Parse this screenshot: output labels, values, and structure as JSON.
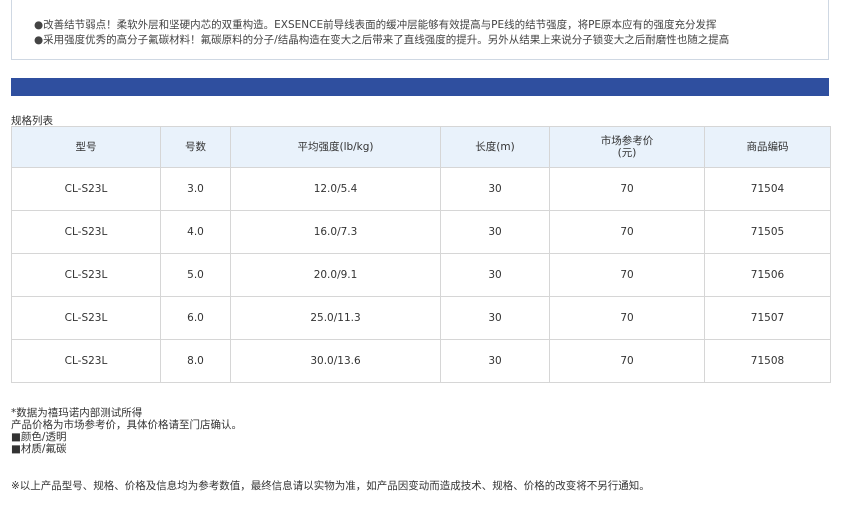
{
  "intro": {
    "line1": "●改善结节弱点！柔软外层和坚硬内芯的双重构造。EXSENCE前导线表面的缓冲层能够有效提高与PE线的结节强度，将PE原本应有的强度充分发挥",
    "line2": "●采用强度优秀的高分子氟碳材料！氟碳原料的分子/结晶构造在变大之后带来了直线强度的提升。另外从结果上来说分子锁变大之后耐磨性也随之提高"
  },
  "spec_title": "规格列表",
  "table": {
    "headers": [
      "型号",
      "号数",
      "平均强度(lb/kg)",
      "长度(m)",
      "市场参考价\n(元)",
      "商品编码"
    ],
    "rows": [
      [
        "CL-S23L",
        "3.0",
        "12.0/5.4",
        "30",
        "70",
        "71504"
      ],
      [
        "CL-S23L",
        "4.0",
        "16.0/7.3",
        "30",
        "70",
        "71505"
      ],
      [
        "CL-S23L",
        "5.0",
        "20.0/9.1",
        "30",
        "70",
        "71506"
      ],
      [
        "CL-S23L",
        "6.0",
        "25.0/11.3",
        "30",
        "70",
        "71507"
      ],
      [
        "CL-S23L",
        "8.0",
        "30.0/13.6",
        "30",
        "70",
        "71508"
      ]
    ]
  },
  "notes": [
    "*数据为禧玛诺内部测试所得",
    "产品价格为市场参考价，具体价格请至门店确认。",
    "■颜色/透明",
    "■材质/氟碳"
  ],
  "disclaimer": "※以上产品型号、规格、价格及信息均为参考数值，最终信息请以实物为准，如产品因变动而造成技术、规格、价格的改变将不另行通知。",
  "colors": {
    "bar": "#2f4f9f",
    "header_bg": "#e9f2fb",
    "border": "#d6d6d6"
  }
}
